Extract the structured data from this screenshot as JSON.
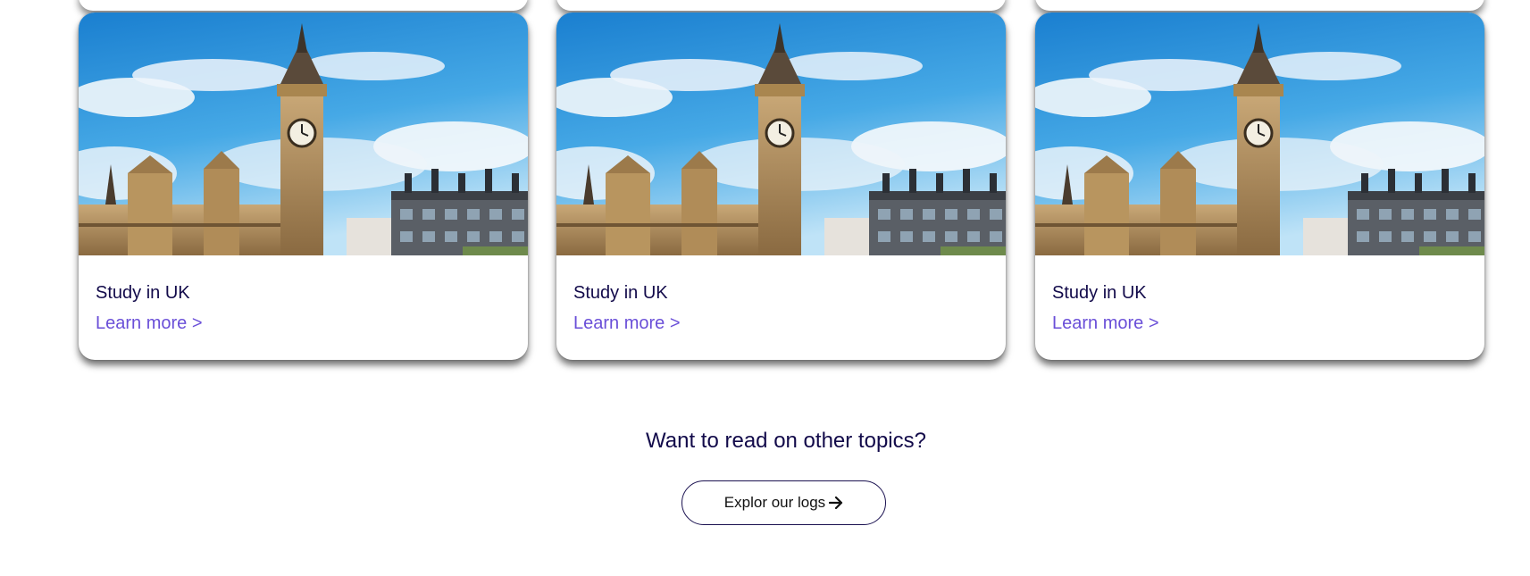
{
  "cards": [
    {
      "title": "Study in UK",
      "link": "Learn more >",
      "image": "big-ben-westminster-photo"
    },
    {
      "title": "Study in UK",
      "link": "Learn more >",
      "image": "big-ben-westminster-photo"
    },
    {
      "title": "Study in UK",
      "link": "Learn more >",
      "image": "big-ben-westminster-photo"
    }
  ],
  "cta": {
    "heading": "Want to read on other topics?",
    "button_label": "Explor our logs",
    "button_icon": "arrow-right-icon"
  },
  "colors": {
    "heading": "#120a4a",
    "link": "#6a4fd8",
    "button_border": "#1a1150"
  }
}
